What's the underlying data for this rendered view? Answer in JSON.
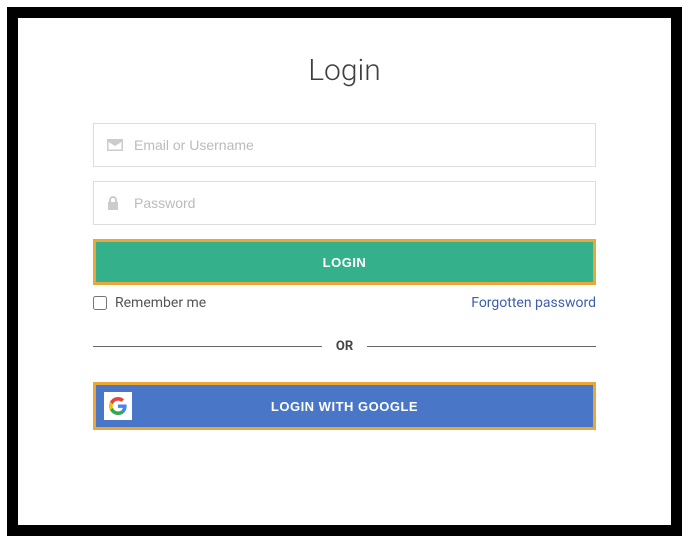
{
  "title": "Login",
  "inputs": {
    "username": {
      "placeholder": "Email or Username",
      "value": ""
    },
    "password": {
      "placeholder": "Password",
      "value": ""
    }
  },
  "loginButton": "LOGIN",
  "rememberLabel": "Remember me",
  "forgotLabel": "Forgotten password",
  "dividerLabel": "OR",
  "googleButton": "LOGIN WITH GOOGLE"
}
